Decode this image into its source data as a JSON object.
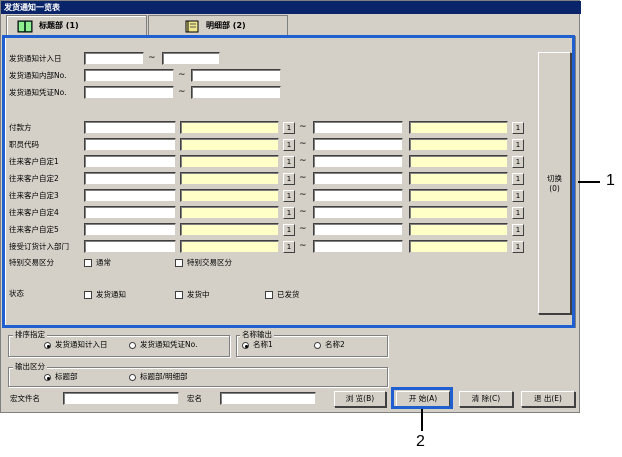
{
  "window": {
    "title": "发货通知一览表"
  },
  "tabs": [
    {
      "label": "标题部 (1)",
      "icon": "book-icon"
    },
    {
      "label": "明细部 (2)",
      "icon": "notebook-icon"
    }
  ],
  "date_rows": [
    {
      "label": "发货通知计入日"
    },
    {
      "label": "发货通知内部No."
    },
    {
      "label": "发货通知凭证No."
    }
  ],
  "range_rows": [
    {
      "label": "付款方"
    },
    {
      "label": "职员代码"
    },
    {
      "label": "往来客户自定1"
    },
    {
      "label": "往来客户自定2"
    },
    {
      "label": "往来客户自定3"
    },
    {
      "label": "往来客户自定4"
    },
    {
      "label": "往来客户自定5"
    },
    {
      "label": "接受订货计入部门"
    }
  ],
  "tilde": "~",
  "lookup": "1",
  "special": {
    "label": "特别交易区分",
    "options": [
      "通常",
      "特别交易区分"
    ]
  },
  "status": {
    "label": "状态",
    "options": [
      "发货通知",
      "发货中",
      "已发货"
    ]
  },
  "switch_button": {
    "label": "切换",
    "key": "(0)"
  },
  "sort": {
    "title": "排序指定",
    "options": [
      "发货通知计入日",
      "发货通知凭证No."
    ],
    "selected": 0
  },
  "name_output": {
    "title": "名称输出",
    "options": [
      "名称1",
      "名称2"
    ],
    "selected": 0
  },
  "output": {
    "title": "输出区分",
    "options": [
      "标题部",
      "标题部/明细部"
    ],
    "selected": 0
  },
  "macro": {
    "file_label": "宏文件名",
    "name_label": "宏名"
  },
  "buttons": {
    "browse": "浏 览(B)",
    "start": "开 始(A)",
    "clear": "清 除(C)",
    "exit": "退 出(E)"
  },
  "callouts": {
    "one": "1",
    "two": "2"
  },
  "colors": {
    "highlight": "#1f5fd0",
    "titlebar": "#0a246a",
    "required": "#ffffc8"
  }
}
